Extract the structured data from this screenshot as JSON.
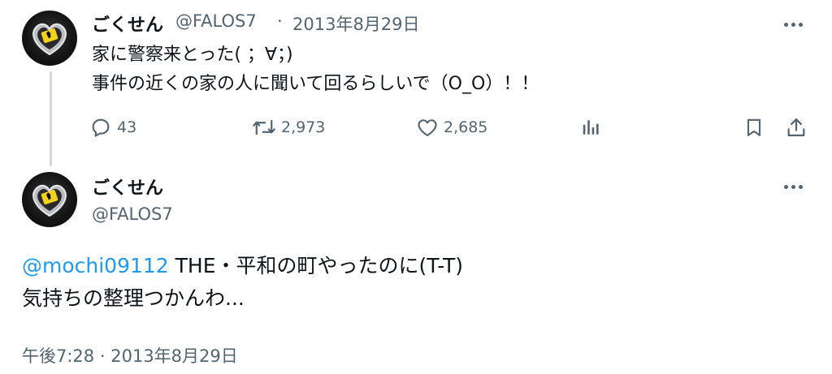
{
  "tweet1": {
    "display_name": "ごくせん",
    "handle": "@FALOS7",
    "separator": "·",
    "date": "2013年8月29日",
    "lines": [
      "家に警察来とった(  ；∀；)",
      "事件の近くの家の人に聞いて回るらしいで（O_O）！！"
    ],
    "actions": {
      "reply_count": "43",
      "retweet_count": "2,973",
      "like_count": "2,685"
    }
  },
  "tweet2": {
    "display_name": "ごくせん",
    "handle": "@FALOS7",
    "mention": "@mochi09112",
    "line1_rest": " THE・平和の町やったのに(T-T)",
    "line2": "気持ちの整理つかんわ...",
    "time": "午後7:28",
    "separator": "·",
    "date": "2013年8月29日"
  },
  "colors": {
    "text": "#0f1419",
    "secondary": "#536471",
    "link": "#1d9bf0",
    "thread_line": "#cfd9de"
  },
  "icons": [
    "more-icon",
    "reply-icon",
    "retweet-icon",
    "like-icon",
    "views-icon",
    "bookmark-icon",
    "share-icon"
  ]
}
